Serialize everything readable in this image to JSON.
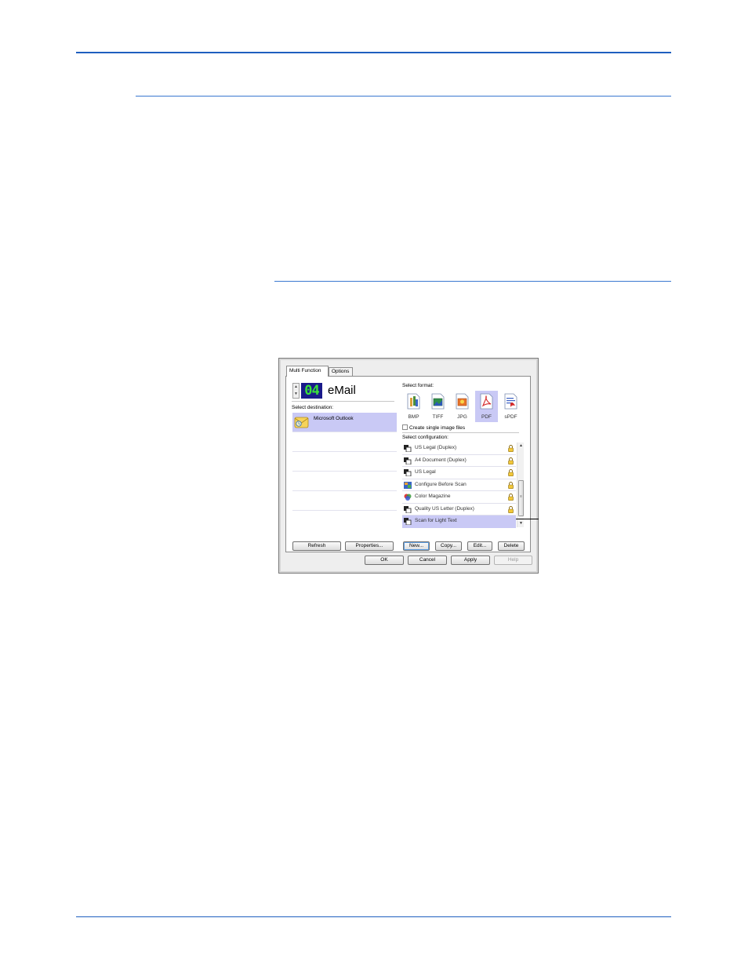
{
  "dialog": {
    "tabs": [
      {
        "label": "Multi Function",
        "active": true
      },
      {
        "label": "Options",
        "active": false
      }
    ],
    "button_number": "04",
    "destination_title": "eMail",
    "select_destination_label": "Select destination:",
    "destinations": [
      {
        "label": "Microsoft Outlook",
        "icon": "outlook-icon",
        "selected": true
      },
      {
        "label": "",
        "selected": false
      },
      {
        "label": "",
        "selected": false
      },
      {
        "label": "",
        "selected": false
      },
      {
        "label": "",
        "selected": false
      },
      {
        "label": "",
        "selected": false
      }
    ],
    "left_buttons": {
      "refresh": "Refresh",
      "properties": "Properties..."
    },
    "select_format_label": "Select format:",
    "formats": [
      {
        "label": "BMP",
        "icon": "bmp-icon",
        "selected": false
      },
      {
        "label": "TIFF",
        "icon": "tiff-icon",
        "selected": false
      },
      {
        "label": "JPG",
        "icon": "jpg-icon",
        "selected": false
      },
      {
        "label": "PDF",
        "icon": "pdf-icon",
        "selected": true
      },
      {
        "label": "sPDF",
        "icon": "spdf-icon",
        "selected": false
      }
    ],
    "create_single_image_files": {
      "label": "Create single image files",
      "checked": false
    },
    "select_configuration_label": "Select configuration:",
    "configurations": [
      {
        "label": "US Legal (Duplex)",
        "icon": "document-icon",
        "locked": true,
        "selected": false
      },
      {
        "label": "A4 Document (Duplex)",
        "icon": "document-icon",
        "locked": true,
        "selected": false
      },
      {
        "label": "US Legal",
        "icon": "document-icon",
        "locked": true,
        "selected": false
      },
      {
        "label": "Configure Before Scan",
        "icon": "configure-icon",
        "locked": true,
        "selected": false
      },
      {
        "label": "Color Magazine",
        "icon": "color-icon",
        "locked": true,
        "selected": false
      },
      {
        "label": "Quality US Letter (Duplex)",
        "icon": "document-icon",
        "locked": true,
        "selected": false
      },
      {
        "label": "Scan for Light Text",
        "icon": "document-icon",
        "locked": false,
        "selected": true
      }
    ],
    "right_buttons": {
      "new": "New...",
      "copy": "Copy...",
      "edit": "Edit...",
      "delete": "Delete"
    },
    "footer_buttons": {
      "ok": "OK",
      "cancel": "Cancel",
      "apply": "Apply",
      "help": "Help"
    }
  },
  "colors": {
    "rule_blue": "#1f5fbf",
    "selection": "#c9c9f5",
    "lcd_background": "#1a1a8a",
    "lcd_digits": "#39e03a"
  }
}
